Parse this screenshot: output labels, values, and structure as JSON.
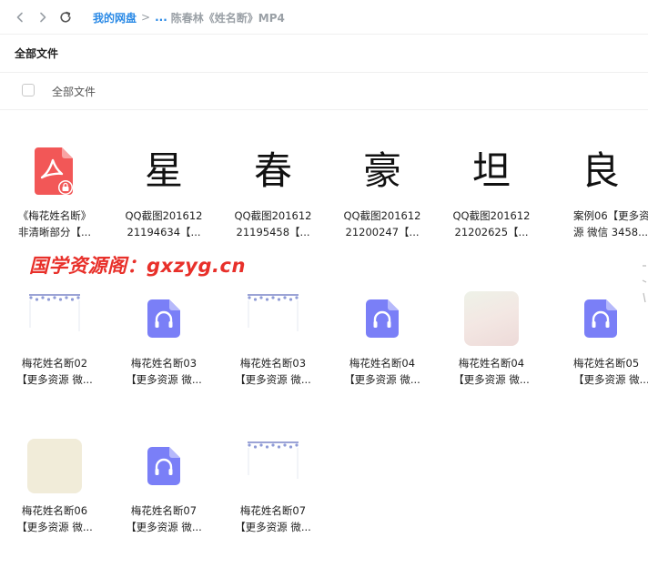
{
  "nav": {
    "back": "chevron-left-icon",
    "forward": "chevron-right-icon",
    "refresh": "refresh-icon"
  },
  "breadcrumb": {
    "root": "我的网盘",
    "ellipsis": "...",
    "current": "陈春林《姓名断》MP4",
    "separator": ">"
  },
  "section": {
    "title": "全部文件"
  },
  "select_all": {
    "label": "全部文件"
  },
  "watermark": "国学资源阁：gxzyg.cn",
  "colors": {
    "link": "#2b8ae6",
    "pdf": "#f25757",
    "audio": "#7a7ff7",
    "watermark": "#e8302a"
  },
  "files": [
    {
      "type": "pdf",
      "line1": "《梅花姓名断》",
      "line2": "非清晰部分【..."
    },
    {
      "type": "image-glyph",
      "glyph": "星",
      "line1": "QQ截图201612",
      "line2": "21194634【..."
    },
    {
      "type": "image-glyph",
      "glyph": "春",
      "line1": "QQ截图201612",
      "line2": "21195458【..."
    },
    {
      "type": "image-glyph",
      "glyph": "豪",
      "line1": "QQ截图201612",
      "line2": "21200247【..."
    },
    {
      "type": "image-glyph",
      "glyph": "坦",
      "line1": "QQ截图201612",
      "line2": "21202625【..."
    },
    {
      "type": "image-glyph",
      "glyph": "良",
      "line1": "案例06【更多资",
      "line2": "源 微信 3458..."
    },
    {
      "type": "banner",
      "line1": "梅花姓名断02",
      "line2": "【更多资源 微..."
    },
    {
      "type": "audio",
      "line1": "梅花姓名断03",
      "line2": "【更多资源 微..."
    },
    {
      "type": "banner",
      "line1": "梅花姓名断03",
      "line2": "【更多资源 微..."
    },
    {
      "type": "audio",
      "line1": "梅花姓名断04",
      "line2": "【更多资源 微..."
    },
    {
      "type": "pale-pink",
      "line1": "梅花姓名断04",
      "line2": "【更多资源 微..."
    },
    {
      "type": "audio",
      "line1": "梅花姓名断05",
      "line2": "【更多资源 微..."
    },
    {
      "type": "pale-cream",
      "line1": "梅花姓名断06",
      "line2": "【更多资源 微..."
    },
    {
      "type": "audio",
      "line1": "梅花姓名断07",
      "line2": "【更多资源 微..."
    },
    {
      "type": "banner",
      "line1": "梅花姓名断07",
      "line2": "【更多资源 微..."
    }
  ]
}
